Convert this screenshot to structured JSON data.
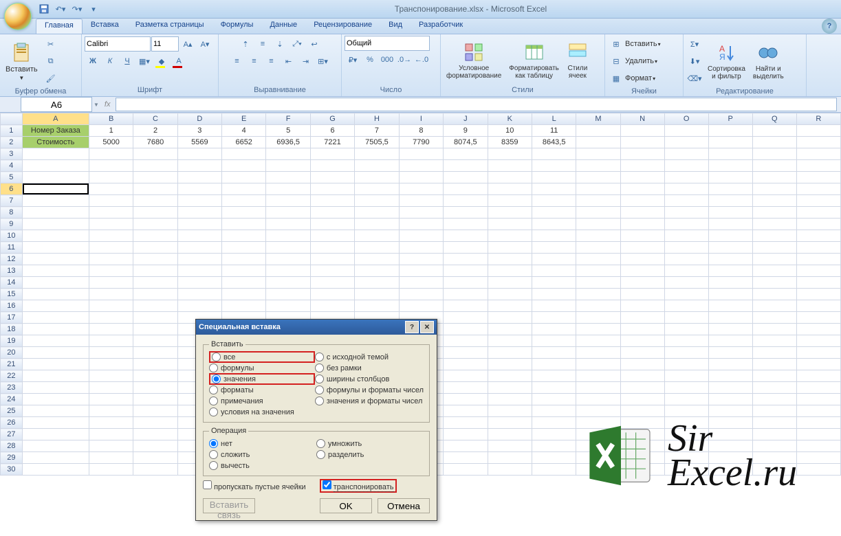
{
  "app_title": "Транспонирование.xlsx - Microsoft Excel",
  "tabs": [
    "Главная",
    "Вставка",
    "Разметка страницы",
    "Формулы",
    "Данные",
    "Рецензирование",
    "Вид",
    "Разработчик"
  ],
  "active_tab": 0,
  "ribbon_groups": {
    "clipboard": "Буфер обмена",
    "paste": "Вставить",
    "font": "Шрифт",
    "align": "Выравнивание",
    "number": "Число",
    "styles": "Стили",
    "cond_fmt": "Условное\nформатирование",
    "fmt_table": "Форматировать\nкак таблицу",
    "cell_styles": "Стили\nячеек",
    "cells": "Ячейки",
    "insert": "Вставить",
    "delete": "Удалить",
    "format": "Формат",
    "editing": "Редактирование",
    "sort": "Сортировка\nи фильтр",
    "find": "Найти и\nвыделить"
  },
  "font_name": "Calibri",
  "font_size": "11",
  "number_format": "Общий",
  "namebox": "A6",
  "cols": [
    "A",
    "B",
    "C",
    "D",
    "E",
    "F",
    "G",
    "H",
    "I",
    "J",
    "K",
    "L",
    "M",
    "N",
    "O",
    "P",
    "Q",
    "R"
  ],
  "row_headers": [
    "1",
    "2",
    "3",
    "4",
    "5",
    "6",
    "7",
    "8",
    "9",
    "10",
    "11",
    "12",
    "13",
    "14",
    "15",
    "16",
    "17",
    "18",
    "19",
    "20",
    "21",
    "22",
    "23",
    "24",
    "25",
    "26",
    "27",
    "28",
    "29",
    "30"
  ],
  "data": {
    "r1": [
      "Номер Заказа",
      "1",
      "2",
      "3",
      "4",
      "5",
      "6",
      "7",
      "8",
      "9",
      "10",
      "11"
    ],
    "r2": [
      "Стоимость",
      "5000",
      "7680",
      "5569",
      "6652",
      "6936,5",
      "7221",
      "7505,5",
      "7790",
      "8074,5",
      "8359",
      "8643,5"
    ]
  },
  "dialog": {
    "title": "Специальная вставка",
    "g_paste": "Вставить",
    "g_op": "Операция",
    "opt_all": "все",
    "opt_formulas": "формулы",
    "opt_values": "значения",
    "opt_formats": "форматы",
    "opt_comments": "примечания",
    "opt_valid": "условия на значения",
    "opt_src_theme": "с исходной темой",
    "opt_no_border": "без рамки",
    "opt_col_width": "ширины столбцов",
    "opt_fm_num": "формулы и форматы чисел",
    "opt_val_num": "значения и форматы чисел",
    "op_none": "нет",
    "op_add": "сложить",
    "op_sub": "вычесть",
    "op_mul": "умножить",
    "op_div": "разделить",
    "skip_blanks": "пропускать пустые ячейки",
    "transpose": "транспонировать",
    "paste_link": "Вставить связь",
    "ok": "OK",
    "cancel": "Отмена"
  },
  "watermark": "Sir\nExcel.ru"
}
